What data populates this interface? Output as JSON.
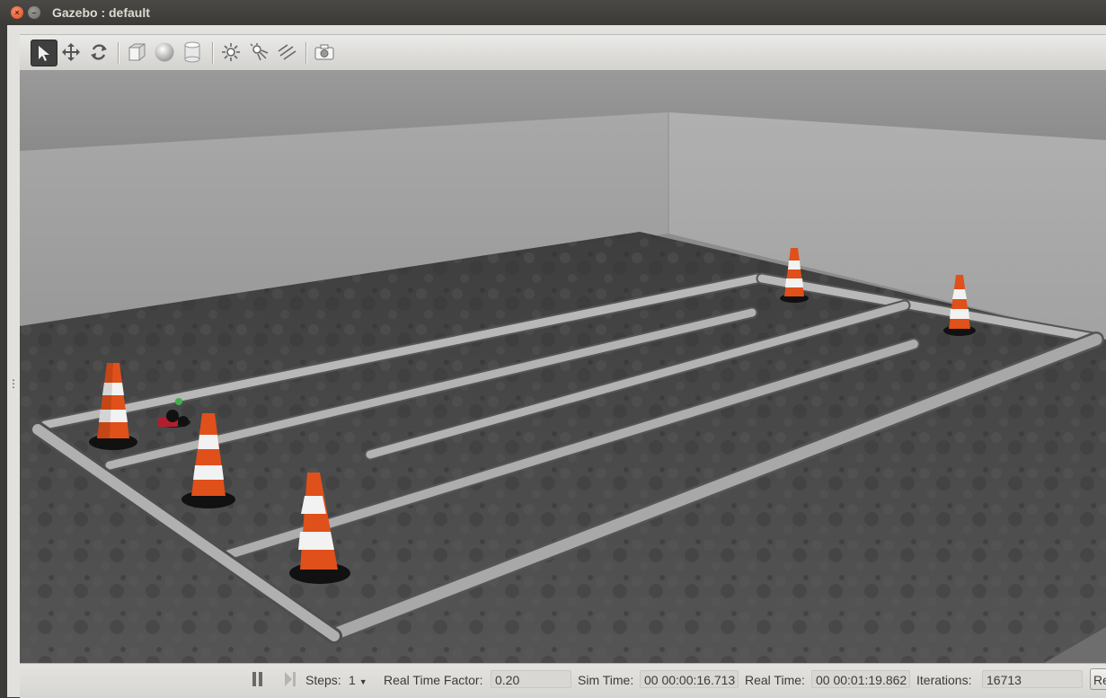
{
  "window": {
    "title": "Gazebo : default"
  },
  "window_controls": {
    "close_glyph": "×",
    "minimize_glyph": "–"
  },
  "toolbar": {
    "tools": [
      {
        "name": "select-mode-icon",
        "active": true
      },
      {
        "name": "translate-mode-icon"
      },
      {
        "name": "rotate-mode-icon"
      },
      {
        "name": "box-shape-icon"
      },
      {
        "name": "sphere-shape-icon"
      },
      {
        "name": "cylinder-shape-icon"
      },
      {
        "name": "point-light-icon"
      },
      {
        "name": "spot-light-icon"
      },
      {
        "name": "directional-light-icon"
      },
      {
        "name": "screenshot-icon"
      }
    ]
  },
  "statusbar": {
    "steps_label": "Steps:",
    "steps_value": "1",
    "rtf_label": "Real Time Factor:",
    "rtf_value": "0.20",
    "sim_time_label": "Sim Time:",
    "sim_time_value": "00 00:00:16.713",
    "real_time_label": "Real Time:",
    "real_time_value": "00 00:01:19.862",
    "iterations_label": "Iterations:",
    "iterations_value": "16713",
    "reset_label": "Re"
  },
  "colors": {
    "sky": "#8c8c8c",
    "wall": "#a3a3a3",
    "ground": "#4a4a4a",
    "pipe": "#9e9e9e",
    "cone_orange": "#e0501a",
    "cone_white": "#f2f2f2",
    "robot_red": "#b21e2d",
    "marker_green": "#3fae4c"
  }
}
